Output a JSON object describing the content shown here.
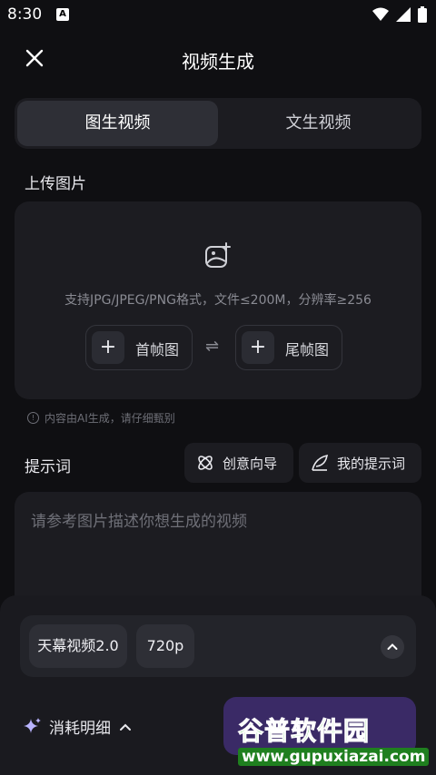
{
  "status_bar": {
    "time": "8:30",
    "notification_glyph": "A"
  },
  "header": {
    "title": "视频生成",
    "close_icon": "close-icon"
  },
  "tabs": [
    {
      "label": "图生视频",
      "active": true
    },
    {
      "label": "文生视频",
      "active": false
    }
  ],
  "upload": {
    "section_title": "上传图片",
    "hint": "支持JPG/JPEG/PNG格式，文件≤200M，分辨率≥256",
    "first_frame_label": "首帧图",
    "last_frame_label": "尾帧图",
    "swap_glyph": "⇌",
    "ai_note": "内容由AI生成，请仔细甄别"
  },
  "prompt": {
    "section_title": "提示词",
    "creative_guide_label": "创意向导",
    "my_prompts_label": "我的提示词",
    "placeholder": "请参考图片描述你想生成的视频"
  },
  "bottom": {
    "model_label": "天幕视频2.0",
    "resolution_label": "720p",
    "cost_label": "消耗明细"
  },
  "watermark": {
    "brand": "谷普软件园",
    "url": "www.gupuxiazai.com"
  },
  "colors": {
    "background": "#0f0f12",
    "card": "#1c1c21",
    "active_tab": "#2e2f36",
    "generate_button": "#3a2a66"
  }
}
